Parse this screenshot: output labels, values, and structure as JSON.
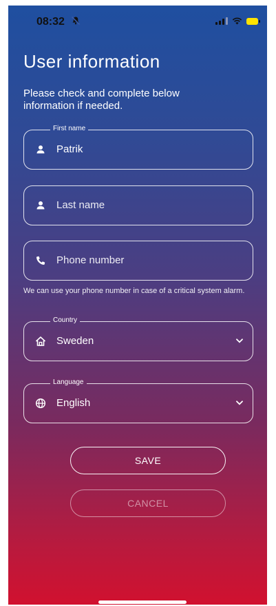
{
  "status_bar": {
    "time": "08:32",
    "bell_icon": "bell-slash-icon",
    "signal_icon": "cellular-signal-icon",
    "wifi_icon": "wifi-icon",
    "battery_icon": "battery-icon",
    "battery_color": "#ffe300"
  },
  "page": {
    "title": "User information",
    "intro": "Please check and complete below information if needed."
  },
  "form": {
    "first_name": {
      "label": "First name",
      "value": "Patrik",
      "icon": "person-icon"
    },
    "last_name": {
      "placeholder": "Last name",
      "icon": "person-icon"
    },
    "phone": {
      "placeholder": "Phone number",
      "icon": "phone-icon"
    },
    "phone_hint": "We can use your phone number in case of a critical system alarm.",
    "country": {
      "label": "Country",
      "value": "Sweden",
      "icon": "home-icon"
    },
    "language": {
      "label": "Language",
      "value": "English",
      "icon": "globe-icon"
    }
  },
  "buttons": {
    "save": "SAVE",
    "cancel": "CANCEL"
  },
  "colors": {
    "gradient_top": "#1f4fa0",
    "gradient_bottom": "#d1112f",
    "text": "#ffffff"
  }
}
